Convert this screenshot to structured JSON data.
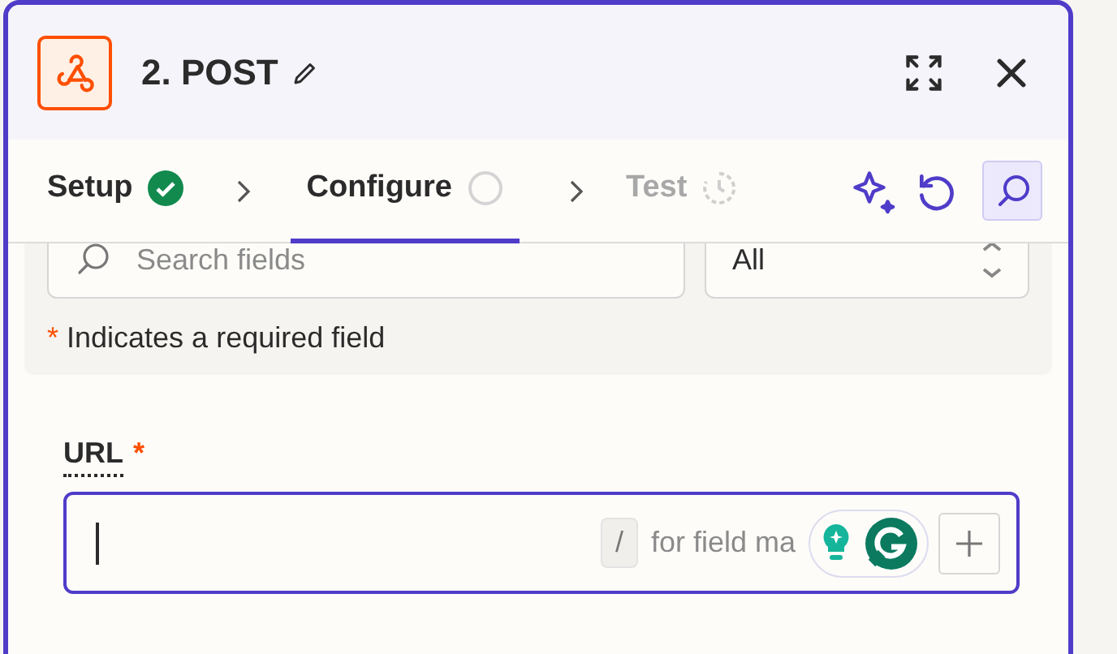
{
  "header": {
    "title": "2. POST"
  },
  "steps": [
    {
      "label": "Setup",
      "kind": "done",
      "selected": false
    },
    {
      "label": "Configure",
      "kind": "pending",
      "selected": true
    },
    {
      "label": "Test",
      "kind": "locked",
      "selected": false
    }
  ],
  "search": {
    "placeholder": "Search fields"
  },
  "filter": {
    "value": "All"
  },
  "required_note": {
    "mark": "*",
    "text": "Indicates a required field"
  },
  "fields": [
    {
      "label": "URL",
      "required": true,
      "focused": true,
      "shortcut_key": "/",
      "hint": "for field ma"
    }
  ]
}
